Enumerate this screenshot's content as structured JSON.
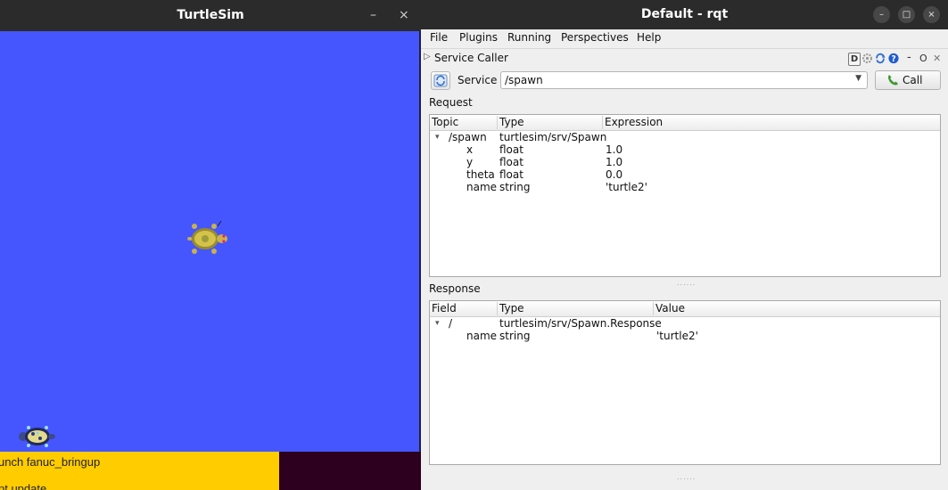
{
  "turtlesim": {
    "title": "TurtleSim",
    "minimize_glyph": "–",
    "close_glyph": "×",
    "background_color": "#4556ff",
    "turtles": [
      {
        "name": "turtle-center",
        "icon": "turtle-icon"
      },
      {
        "name": "turtle-bottom-left",
        "icon": "turtle-icon"
      }
    ]
  },
  "terminal": {
    "lines": [
      "unch fanuc_bringup",
      "pt update"
    ],
    "highlight_color": "#ffcc00"
  },
  "rqt": {
    "title": "Default - rqt",
    "window_buttons": {
      "minimize": "–",
      "maximize": "□",
      "close": "×"
    },
    "menu": [
      "File",
      "Plugins",
      "Running",
      "Perspectives",
      "Help"
    ],
    "plugin": {
      "title": "Service Caller",
      "header_icons": [
        "D",
        "gear-icon",
        "refresh-icon",
        "help-icon"
      ],
      "minimize": "-",
      "float": "O",
      "close": "✕"
    },
    "toolbar": {
      "service_label": "Service",
      "service_value": "/spawn",
      "call_label": "Call"
    },
    "request": {
      "label": "Request",
      "columns": [
        "Topic",
        "Type",
        "Expression"
      ],
      "rows": [
        {
          "topic": "/spawn",
          "type": "turtlesim/srv/Spawn",
          "expression": "",
          "expanded": true
        },
        {
          "topic": "x",
          "type": "float",
          "expression": "1.0"
        },
        {
          "topic": "y",
          "type": "float",
          "expression": "1.0"
        },
        {
          "topic": "theta",
          "type": "float",
          "expression": "0.0"
        },
        {
          "topic": "name",
          "type": "string",
          "expression": "'turtle2'"
        }
      ]
    },
    "response": {
      "label": "Response",
      "columns": [
        "Field",
        "Type",
        "Value"
      ],
      "rows": [
        {
          "field": "/",
          "type": "turtlesim/srv/Spawn.Response",
          "value": "",
          "expanded": true
        },
        {
          "field": "name",
          "type": "string",
          "value": "'turtle2'"
        }
      ]
    }
  }
}
